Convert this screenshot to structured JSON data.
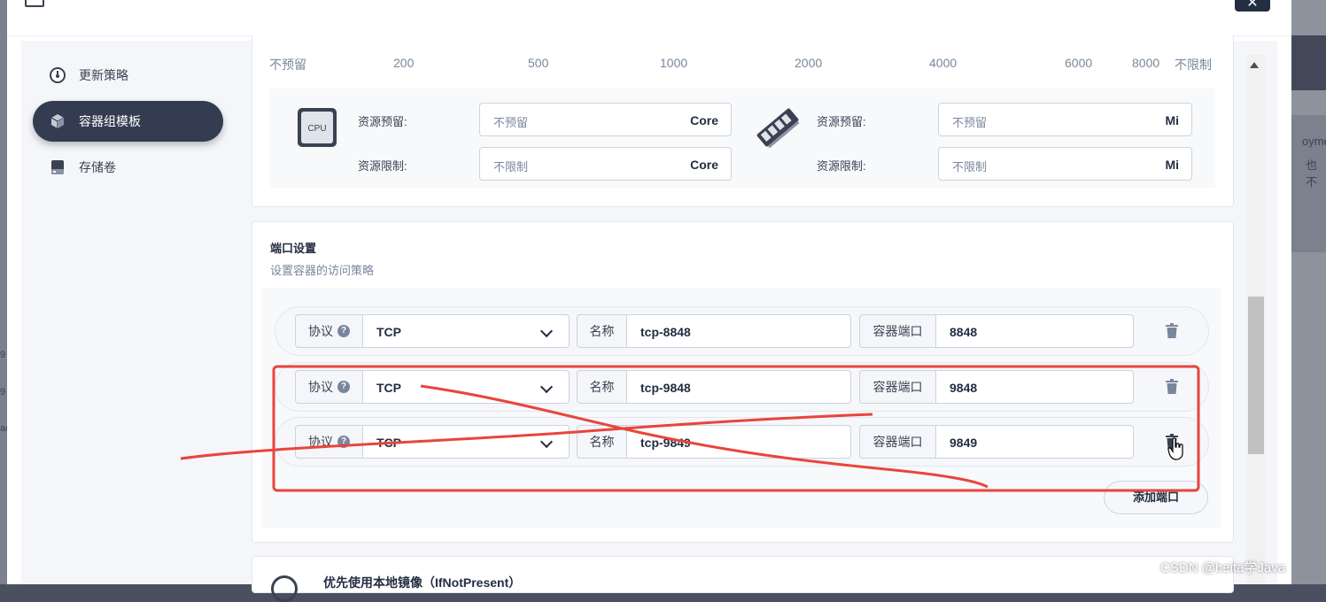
{
  "background": {
    "fragments": [
      "oyme",
      "也不",
      "9",
      "9",
      "ac"
    ]
  },
  "sidebar": {
    "items": [
      {
        "label": "更新策略",
        "icon": "update-strategy-icon",
        "active": false
      },
      {
        "label": "容器组模板",
        "icon": "pod-template-icon",
        "active": true
      },
      {
        "label": "存储卷",
        "icon": "storage-volume-icon",
        "active": false
      }
    ]
  },
  "resource": {
    "scale": [
      "不预留",
      "200",
      "500",
      "1000",
      "2000",
      "4000",
      "6000",
      "8000",
      "不限制"
    ],
    "cpu": {
      "icon_text": "CPU",
      "reserve_label": "资源预留:",
      "reserve_placeholder": "不预留",
      "reserve_unit": "Core",
      "limit_label": "资源限制:",
      "limit_placeholder": "不限制",
      "limit_unit": "Core"
    },
    "memory": {
      "reserve_label": "资源预留:",
      "reserve_placeholder": "不预留",
      "reserve_unit": "Mi",
      "limit_label": "资源限制:",
      "limit_placeholder": "不限制",
      "limit_unit": "Mi"
    }
  },
  "ports": {
    "title": "端口设置",
    "description": "设置容器的访问策略",
    "protocol_label": "协议",
    "name_label": "名称",
    "container_port_label": "容器端口",
    "rows": [
      {
        "protocol": "TCP",
        "name": "tcp-8848",
        "port": "8848"
      },
      {
        "protocol": "TCP",
        "name": "tcp-9848",
        "port": "9848"
      },
      {
        "protocol": "TCP",
        "name": "tcp-9849",
        "port": "9849"
      }
    ],
    "add_button": "添加端口"
  },
  "image_policy": {
    "label": "优先使用本地镜像（IfNotPresent）"
  },
  "watermark": "CSDN @beita学Java",
  "colors": {
    "accent_dark": "#343c51",
    "annotation_red": "#e8453c"
  }
}
